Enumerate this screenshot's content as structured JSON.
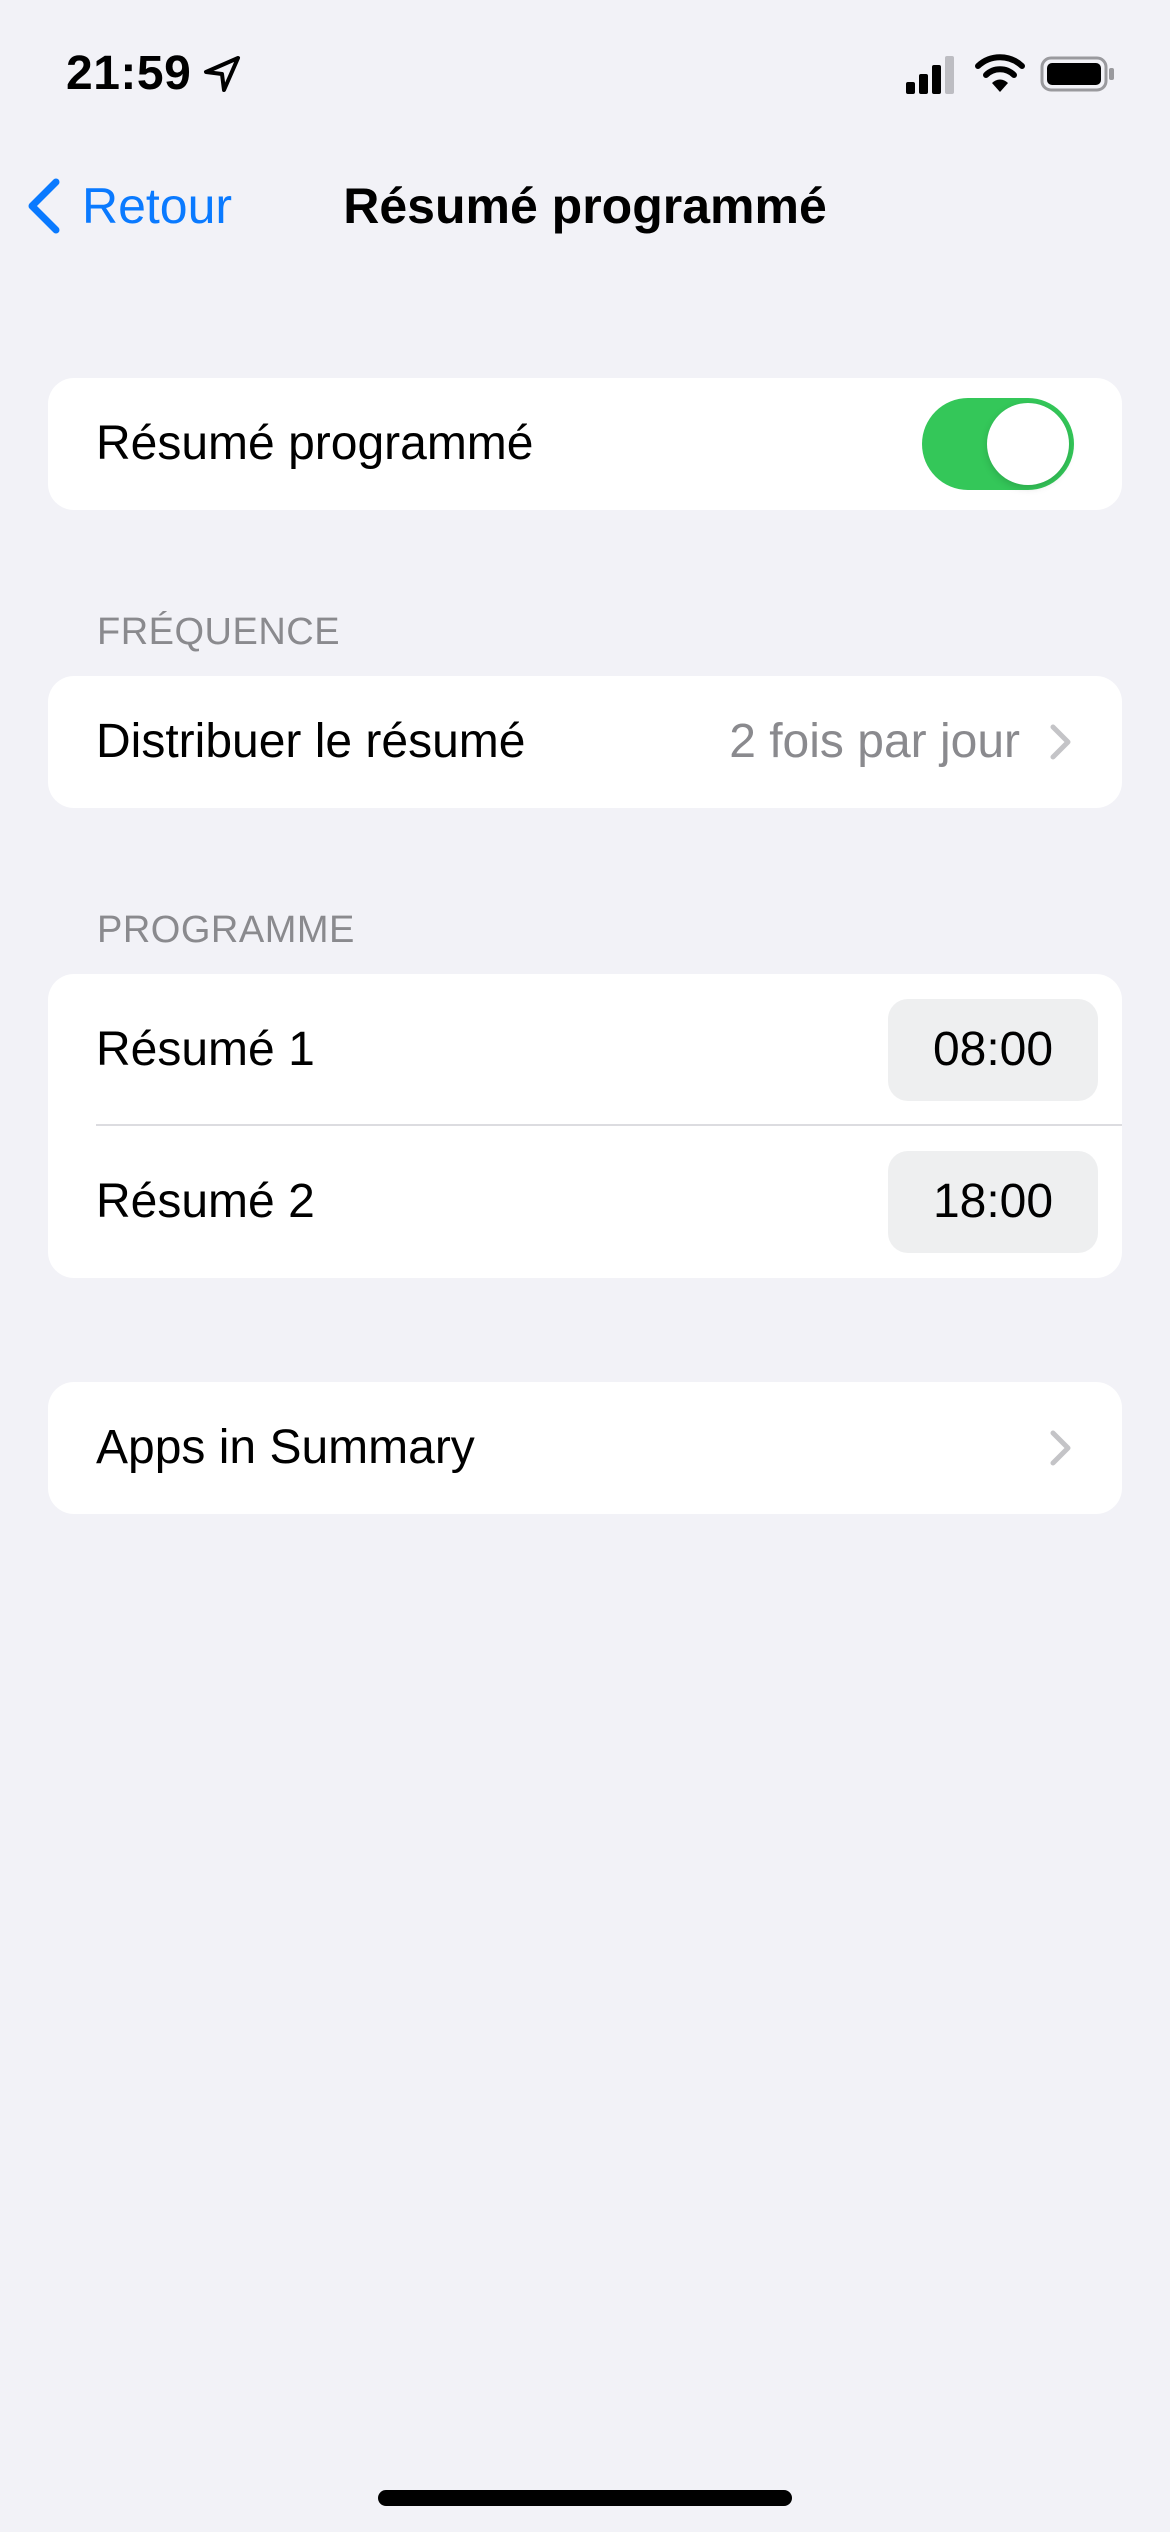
{
  "status_bar": {
    "time": "21:59",
    "icons": [
      "location-icon",
      "signal-icon",
      "wifi-icon",
      "battery-icon"
    ]
  },
  "nav": {
    "back_label": "Retour",
    "title": "Résumé programmé"
  },
  "main_toggle": {
    "label": "Résumé programmé",
    "on": true
  },
  "frequency_section": {
    "header": "FRÉQUENCE",
    "row_label": "Distribuer le résumé",
    "row_value": "2 fois par jour"
  },
  "schedule_section": {
    "header": "PROGRAMME",
    "rows": [
      {
        "label": "Résumé 1",
        "time": "08:00"
      },
      {
        "label": "Résumé 2",
        "time": "18:00"
      }
    ]
  },
  "apps_row": {
    "label": "Apps in Summary"
  },
  "colors": {
    "accent": "#0A7AFF",
    "toggle_on": "#34C759",
    "background": "#F2F2F7",
    "secondary_text": "#8A8A8E"
  }
}
